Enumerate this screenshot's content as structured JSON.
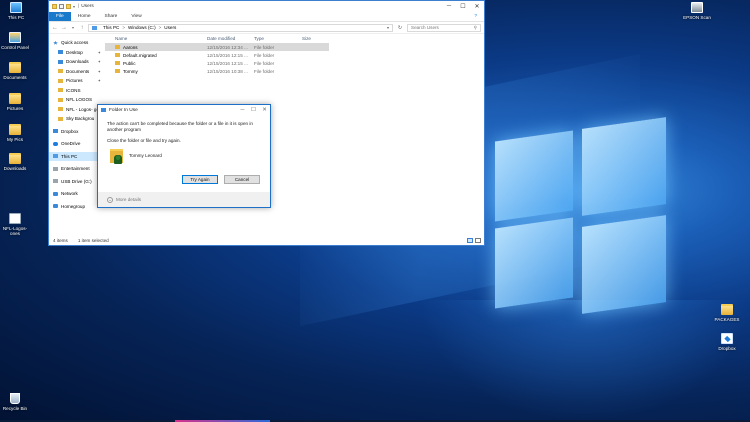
{
  "desktop": {
    "icons": [
      {
        "label": "This PC",
        "icon": "this-pc-icon"
      },
      {
        "label": "Control Panel",
        "icon": "control-panel-icon"
      },
      {
        "label": "Documents",
        "icon": "documents-icon"
      },
      {
        "label": "Pictures",
        "icon": "pictures-icon"
      },
      {
        "label": "My Pics",
        "icon": "folder-icon"
      },
      {
        "label": "Downloads",
        "icon": "downloads-icon"
      },
      {
        "label": "NFL-Logos-ones",
        "icon": "document-icon"
      },
      {
        "label": "Recycle Bin",
        "icon": "recycle-bin-icon"
      },
      {
        "label": "EPSON Scan",
        "icon": "scanner-icon"
      },
      {
        "label": "PACKAGES",
        "icon": "folder-icon"
      },
      {
        "label": "Dropbox",
        "icon": "dropbox-icon"
      }
    ]
  },
  "explorer": {
    "title": "Users",
    "window_controls": {
      "minimize": "─",
      "maximize": "☐",
      "close": "✕"
    },
    "ribbon": {
      "file": "File",
      "home": "Home",
      "share": "Share",
      "view": "View",
      "help": "?"
    },
    "nav_buttons": {
      "back": "←",
      "forward": "→",
      "up": "↑"
    },
    "address": {
      "root": "This PC",
      "drive": "Windows (C:)",
      "folder": "Users",
      "separator": ">"
    },
    "search_placeholder": "Search Users",
    "nav_pane": {
      "quick_access": "Quick access",
      "desktop": "Desktop",
      "downloads": "Downloads",
      "documents": "Documents",
      "pictures": "Pictures",
      "icons": "ICONS",
      "nfl_logos": "NFL LOGOS",
      "nfl_logos_go": "NFL - Logos- go",
      "sky": "Sky Backgrou",
      "dropbox": "Dropbox",
      "onedrive": "OneDrive",
      "this_pc": "This PC",
      "entertainment": "Entertainment",
      "usb": "USB Drive (G:)",
      "network": "Network",
      "homegroup": "Homegroup"
    },
    "columns": {
      "name": "Name",
      "date": "Date modified",
      "type": "Type",
      "size": "Size"
    },
    "files": [
      {
        "name": "Aarons",
        "date": "12/15/2016 12:34 ...",
        "type": "File folder"
      },
      {
        "name": "Default.migrated",
        "date": "12/15/2016 12:15 ...",
        "type": "File folder"
      },
      {
        "name": "Public",
        "date": "12/15/2016 12:15 ...",
        "type": "File folder"
      },
      {
        "name": "Tommy",
        "date": "12/15/2016 10:38 ...",
        "type": "File folder"
      }
    ],
    "status": {
      "items": "4 items",
      "selected": "1 item selected"
    }
  },
  "dialog": {
    "title": "Folder In Use",
    "message": "The action can't be completed because the folder or a file in it is open in another program",
    "instruction": "Close the folder or file and try again.",
    "file_name": "Tommy Leonard",
    "try_again": "Try Again",
    "cancel": "Cancel",
    "more_details": "More details",
    "close": "✕",
    "minimize": "─",
    "maximize": "☐"
  }
}
